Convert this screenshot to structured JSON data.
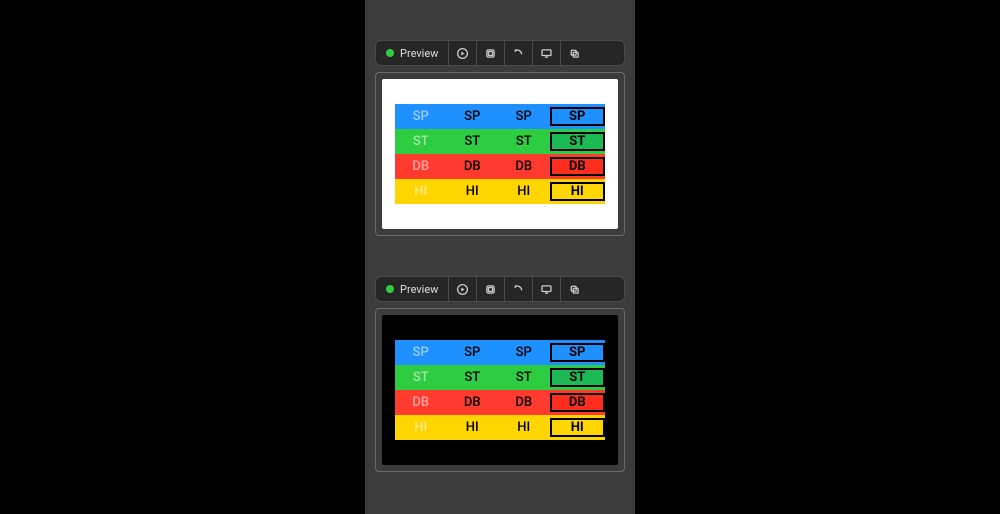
{
  "toolbar": {
    "label": "Preview"
  },
  "panes": [
    "light",
    "dark"
  ],
  "rows": [
    {
      "bg": "blue",
      "boxClass": "blue",
      "cells": {
        "c1": "SP",
        "c2": "SP",
        "c3": "SP",
        "c4": "SP"
      }
    },
    {
      "bg": "green",
      "boxClass": "green",
      "cells": {
        "c1": "ST",
        "c2": "ST",
        "c3": "ST",
        "c4": "ST"
      }
    },
    {
      "bg": "red",
      "boxClass": "red",
      "cells": {
        "c1": "DB",
        "c2": "DB",
        "c3": "DB",
        "c4": "DB"
      }
    },
    {
      "bg": "yellow",
      "boxClass": "yellow",
      "cells": {
        "c1": "HI",
        "c2": "HI",
        "c3": "HI",
        "c4": "HI"
      }
    }
  ]
}
